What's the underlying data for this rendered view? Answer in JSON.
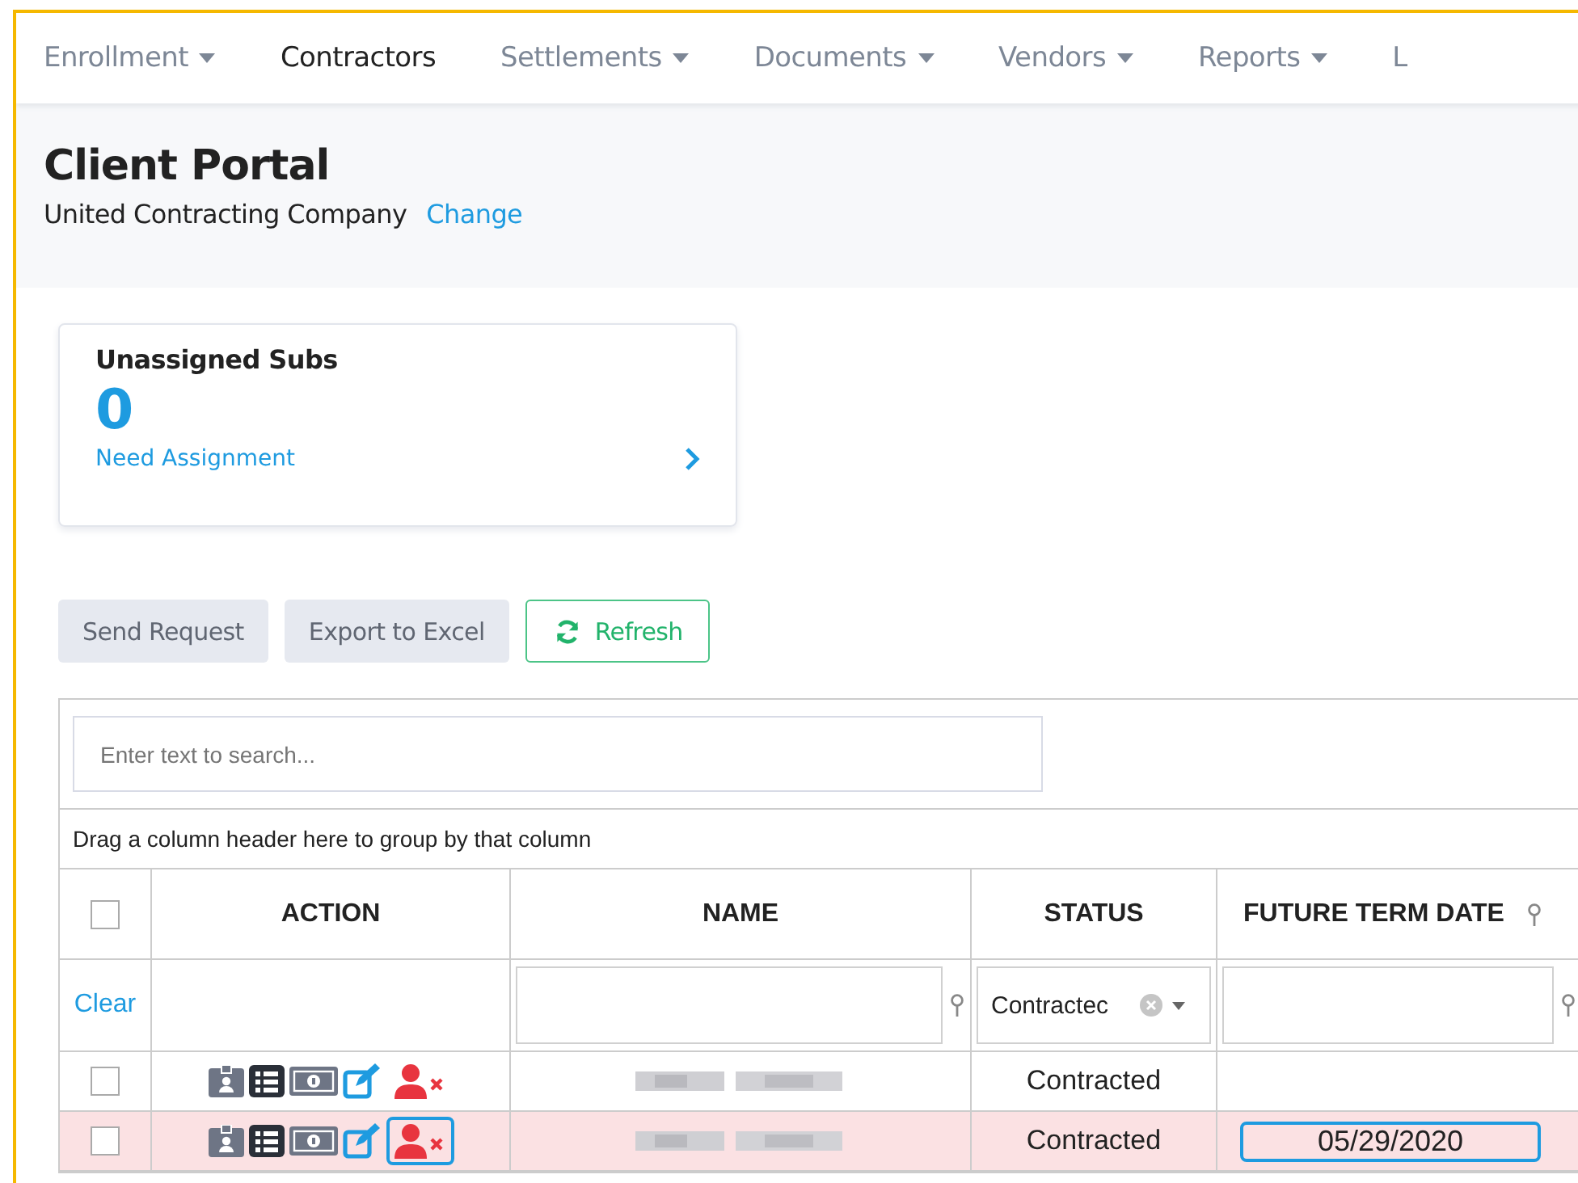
{
  "nav": [
    {
      "label": "Enrollment",
      "caret": true,
      "selected": false
    },
    {
      "label": "Contractors",
      "caret": false,
      "selected": true
    },
    {
      "label": "Settlements",
      "caret": true,
      "selected": false
    },
    {
      "label": "Documents",
      "caret": true,
      "selected": false
    },
    {
      "label": "Vendors",
      "caret": true,
      "selected": false
    },
    {
      "label": "Reports",
      "caret": true,
      "selected": false
    },
    {
      "label": "L",
      "caret": false,
      "selected": false
    }
  ],
  "header": {
    "title": "Client Portal",
    "company": "United Contracting Company",
    "change_link": "Change"
  },
  "card": {
    "title": "Unassigned Subs",
    "count": "0",
    "link": "Need Assignment"
  },
  "buttons": [
    {
      "label": "Send Request",
      "kind": "plain"
    },
    {
      "label": "Export to Excel",
      "kind": "plain"
    },
    {
      "label": "Refresh",
      "kind": "refresh"
    }
  ],
  "grid": {
    "search": {
      "placeholder": "Enter text to search..."
    },
    "group_hint": "Drag a column header here to group by that column",
    "columns": [
      "ACTION",
      "NAME",
      "STATUS",
      "FUTURE TERM DATE"
    ],
    "header_checked": false,
    "filter": {
      "clear": "Clear",
      "status_value": "Contractec"
    },
    "rows": [
      {
        "checked": false,
        "selected": false,
        "focused": false,
        "status": "Contracted",
        "future_term_date": ""
      },
      {
        "checked": false,
        "selected": true,
        "focused": true,
        "status": "Contracted",
        "future_term_date": "05/29/2020"
      }
    ]
  }
}
